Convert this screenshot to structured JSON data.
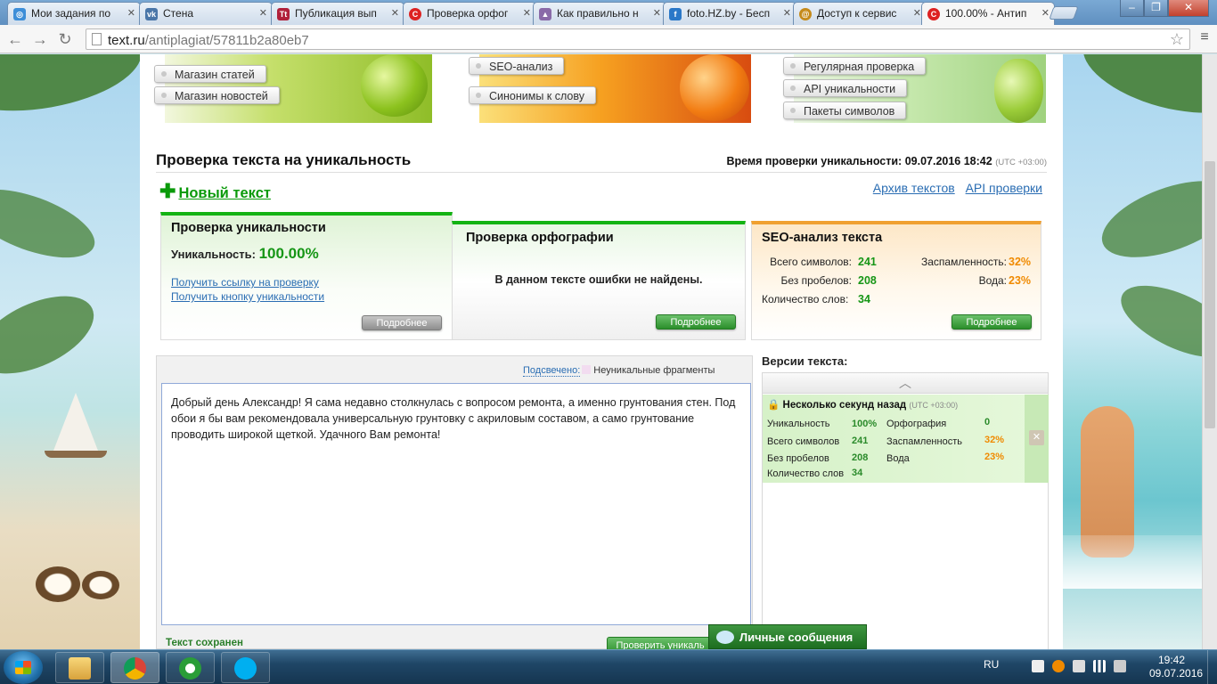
{
  "browser": {
    "tabs": [
      {
        "title": "Мои задания по",
        "icon": "advego-icon",
        "color": "#3d8ed8",
        "active": false
      },
      {
        "title": "Стена",
        "icon": "vk-icon",
        "color": "#4a76a8",
        "active": false
      },
      {
        "title": "Публикация вып",
        "icon": "tt-icon",
        "color": "#b0203a",
        "active": false
      },
      {
        "title": "Проверка орфог",
        "icon": "textru-icon",
        "color": "#d22",
        "active": false
      },
      {
        "title": "Как правильно н",
        "icon": "image-icon",
        "color": "#8a6aa8",
        "active": false
      },
      {
        "title": "foto.HZ.by - Бесп",
        "icon": "fotohz-icon",
        "color": "#2a78c8",
        "active": false
      },
      {
        "title": "Доступ к сервис",
        "icon": "service-icon",
        "color": "#c58a1a",
        "active": false
      },
      {
        "title": "100.00% - Антип",
        "icon": "textru-icon",
        "color": "#d22",
        "active": true
      }
    ],
    "url_host": "text.ru",
    "url_path": "/antiplagiat/57811b2a80eb7"
  },
  "banner": {
    "links_left": [
      "Магазин статей",
      "Магазин новостей"
    ],
    "links_middle": [
      "SEO-анализ",
      "Синонимы к слову"
    ],
    "links_right": [
      "Регулярная проверка",
      "API уникальности",
      "Пакеты символов"
    ]
  },
  "header": {
    "title": "Проверка текста на уникальность",
    "check_time_label": "Время проверки уникальности: 09.07.2016 18:42",
    "check_time_tz": "(UTC +03:00)",
    "new_text": "Новый текст",
    "archive_link": "Архив текстов",
    "api_link": "API проверки"
  },
  "cards": {
    "uniqueness": {
      "title": "Проверка уникальности",
      "label": "Уникальность:",
      "value": "100.00%",
      "link1": "Получить ссылку на проверку",
      "link2": "Получить кнопку уникальности",
      "button": "Подробнее"
    },
    "spelling": {
      "title": "Проверка орфографии",
      "message": "В данном тексте ошибки не найдены.",
      "button": "Подробнее"
    },
    "seo": {
      "title": "SEO-анализ текста",
      "chars_label": "Всего символов:",
      "chars_value": "241",
      "nospace_label": "Без пробелов:",
      "nospace_value": "208",
      "words_label": "Количество слов:",
      "words_value": "34",
      "spam_label": "Заспамленность:",
      "spam_value": "32%",
      "water_label": "Вода:",
      "water_value": "23%",
      "button": "Подробнее"
    }
  },
  "editor": {
    "highlight_link": "Подсвечено:",
    "highlight_legend": "Неуникальные фрагменты",
    "text": "Добрый день Александр! Я сама недавно столкнулась с вопросом ремонта, а именно грунтования стен. Под обои я бы вам рекомендовала универсальную грунтовку с акриловым составом, а само грунтование проводить широкой щеткой. Удачного Вам ремонта!",
    "saved": "Текст сохранен",
    "check_button": "Проверить уникаль"
  },
  "versions": {
    "title": "Версии текста:",
    "item_head": "Несколько секунд назад",
    "item_tz": "(UTC +03:00)",
    "uniq_label": "Уникальность",
    "uniq_value": "100%",
    "spell_label": "Орфография",
    "spell_value": "0",
    "chars_label": "Всего символов",
    "chars_value": "241",
    "spam_label": "Заспамленность",
    "spam_value": "32%",
    "nospace_label": "Без пробелов",
    "nospace_value": "208",
    "water_label": "Вода",
    "water_value": "23%",
    "words_label": "Количество слов",
    "words_value": "34"
  },
  "private_messages": "Личные сообщения",
  "taskbar": {
    "lang": "RU",
    "time": "19:42",
    "date": "09.07.2016",
    "apps": [
      "explorer-icon",
      "chrome-icon",
      "utorrent-icon",
      "skype-icon"
    ]
  }
}
